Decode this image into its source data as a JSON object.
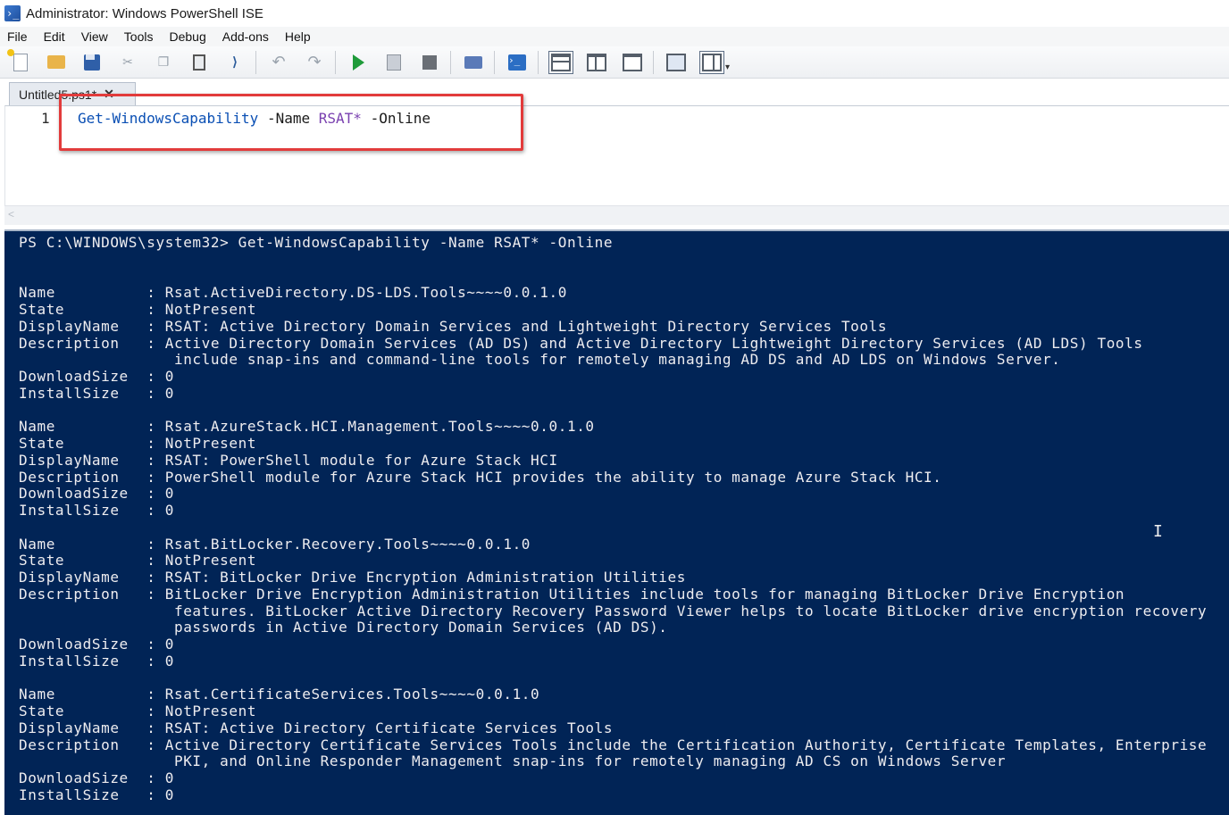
{
  "window": {
    "title": "Administrator: Windows PowerShell ISE"
  },
  "menu": [
    "File",
    "Edit",
    "View",
    "Tools",
    "Debug",
    "Add-ons",
    "Help"
  ],
  "toolbar": {
    "icons": [
      "new-script-icon",
      "open-icon",
      "save-icon",
      "cut-icon",
      "copy-icon",
      "paste-icon",
      "clear-console-icon",
      "undo-icon",
      "redo-icon",
      "run-script-icon",
      "run-selection-icon",
      "stop-icon",
      "new-remote-tab-icon",
      "powershell-icon",
      "script-pane-top-icon",
      "script-pane-right-icon",
      "script-pane-maximized-icon",
      "show-command-window-icon",
      "show-command-addon-icon"
    ]
  },
  "tab": {
    "label": "Untitled5.ps1*",
    "close": "✕"
  },
  "editor": {
    "line_number": "1",
    "cmdlet": "Get-WindowsCapability",
    "param1": "-Name",
    "arg1": "RSAT*",
    "param2": "-Online"
  },
  "console": {
    "prompt": "PS C:\\WINDOWS\\system32> Get-WindowsCapability -Name RSAT* -Online",
    "records": [
      {
        "Name": "Rsat.ActiveDirectory.DS-LDS.Tools~~~~0.0.1.0",
        "State": "NotPresent",
        "DisplayName": "RSAT: Active Directory Domain Services and Lightweight Directory Services Tools",
        "Description": [
          "Active Directory Domain Services (AD DS) and Active Directory Lightweight Directory Services (AD LDS) Tools",
          "include snap-ins and command-line tools for remotely managing AD DS and AD LDS on Windows Server."
        ],
        "DownloadSize": "0",
        "InstallSize": "0"
      },
      {
        "Name": "Rsat.AzureStack.HCI.Management.Tools~~~~0.0.1.0",
        "State": "NotPresent",
        "DisplayName": "RSAT: PowerShell module for Azure Stack HCI",
        "Description": [
          "PowerShell module for Azure Stack HCI provides the ability to manage Azure Stack HCI."
        ],
        "DownloadSize": "0",
        "InstallSize": "0"
      },
      {
        "Name": "Rsat.BitLocker.Recovery.Tools~~~~0.0.1.0",
        "State": "NotPresent",
        "DisplayName": "RSAT: BitLocker Drive Encryption Administration Utilities",
        "Description": [
          "BitLocker Drive Encryption Administration Utilities include tools for managing BitLocker Drive Encryption",
          "features. BitLocker Active Directory Recovery Password Viewer helps to locate BitLocker drive encryption recovery",
          "passwords in Active Directory Domain Services (AD DS)."
        ],
        "DownloadSize": "0",
        "InstallSize": "0"
      },
      {
        "Name": "Rsat.CertificateServices.Tools~~~~0.0.1.0",
        "State": "NotPresent",
        "DisplayName": "RSAT: Active Directory Certificate Services Tools",
        "Description": [
          "Active Directory Certificate Services Tools include the Certification Authority, Certificate Templates, Enterprise",
          "PKI, and Online Responder Management snap-ins for remotely managing AD CS on Windows Server"
        ],
        "DownloadSize": "0",
        "InstallSize": "0"
      }
    ]
  },
  "colors": {
    "console_bg": "#012456",
    "console_fg": "#eeedf0",
    "highlight_border": "#e23b3b",
    "cmdlet": "#0a4fb4",
    "argument": "#7a41b0"
  }
}
